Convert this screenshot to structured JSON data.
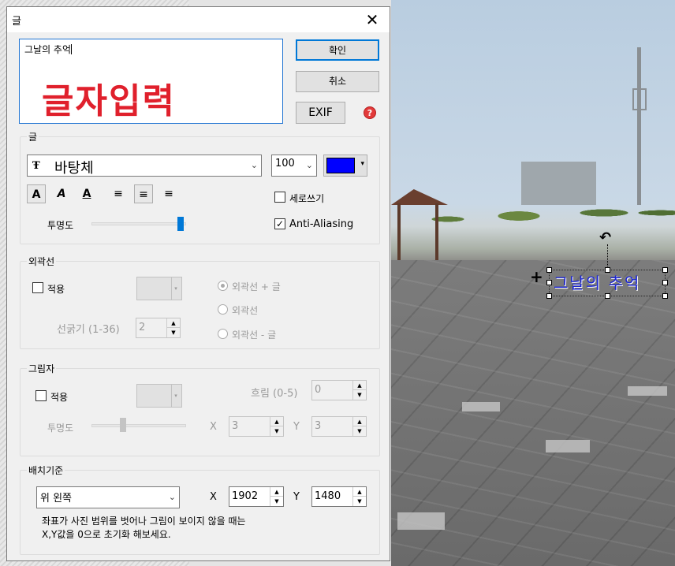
{
  "dialog": {
    "title": "글",
    "close_symbol": "✕",
    "text_input": "그날의 추억",
    "hint_text": "글자입력",
    "ok_label": "확인",
    "cancel_label": "취소",
    "exif_label": "EXIF",
    "help_symbol": "?"
  },
  "text_group": {
    "label": "글",
    "font_icon": "Ŧ",
    "font_value": "바탕체",
    "size_value": "100",
    "color": "#0000ff",
    "bold_label": "A",
    "italic_label": "A",
    "underline_label": "A",
    "vertical_label": "세로쓰기",
    "vertical_checked": false,
    "antialias_label": "Anti-Aliasing",
    "antialias_checked": true,
    "opacity_label": "투명도",
    "opacity_level": 1.0
  },
  "outline_group": {
    "label": "외곽선",
    "apply_label": "적용",
    "thickness_label": "선굵기 (1-36)",
    "thickness_value": "2",
    "options": [
      "외곽선 + 글",
      "외곽선",
      "외곽선 - 글"
    ],
    "selected_option": 0
  },
  "shadow_group": {
    "label": "그림자",
    "apply_label": "적용",
    "blur_label": "흐림 (0-5)",
    "blur_value": "0",
    "opacity_label": "투명도",
    "x_label": "X",
    "x_value": "3",
    "y_label": "Y",
    "y_value": "3"
  },
  "placement_group": {
    "label": "배치기준",
    "anchor_value": "위 왼쪽",
    "x_label": "X",
    "x_value": "1902",
    "y_label": "Y",
    "y_value": "1480",
    "note_line1": "좌표가 사진 범위를 벗어나 그림이 보이지 않을 때는",
    "note_line2": "X,Y값을 0으로 초기화 해보세요."
  },
  "photo": {
    "overlay_text": "그날의 추억",
    "overlay_color": "#1a24d6"
  }
}
